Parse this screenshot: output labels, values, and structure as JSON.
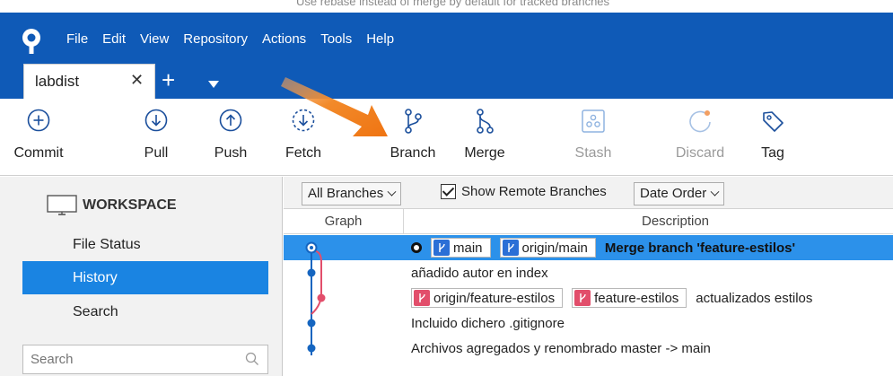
{
  "top_strip_text": "Use rebase instead of merge by default for tracked branches",
  "menu": [
    "File",
    "Edit",
    "View",
    "Repository",
    "Actions",
    "Tools",
    "Help"
  ],
  "tab": {
    "label": "labdist",
    "close": "✕",
    "add": "+"
  },
  "toolbar": {
    "commit": "Commit",
    "pull": "Pull",
    "push": "Push",
    "fetch": "Fetch",
    "branch": "Branch",
    "merge": "Merge",
    "stash": "Stash",
    "discard": "Discard",
    "tag": "Tag"
  },
  "sidebar": {
    "workspace": "WORKSPACE",
    "items": [
      "File Status",
      "History",
      "Search"
    ],
    "selected": "History",
    "search_placeholder": "Search"
  },
  "filters": {
    "branches": "All Branches",
    "show_remote": "Show Remote Branches",
    "show_remote_checked": true,
    "order": "Date Order"
  },
  "columns": {
    "graph": "Graph",
    "description": "Description"
  },
  "commits": [
    {
      "badges": [
        {
          "name": "main",
          "color": "blue"
        },
        {
          "name": "origin/main",
          "color": "blue"
        }
      ],
      "message": "Merge branch 'feature-estilos'",
      "head": true,
      "selected": true
    },
    {
      "badges": [],
      "message": "añadido autor en index"
    },
    {
      "badges": [
        {
          "name": "origin/feature-estilos",
          "color": "red"
        },
        {
          "name": "feature-estilos",
          "color": "red"
        }
      ],
      "message": "actualizados estilos"
    },
    {
      "badges": [],
      "message": "Incluido dichero .gitignore"
    },
    {
      "badges": [],
      "message": "Archivos agregados y renombrado master -> main"
    }
  ],
  "colors": {
    "titlebar": "#0f5ab7",
    "selection": "#2c91ea",
    "sidebar_selected": "#1a84e2",
    "graph_blue": "#1565c0",
    "graph_pink": "#e24e6b",
    "arrow": "#f07a16"
  }
}
